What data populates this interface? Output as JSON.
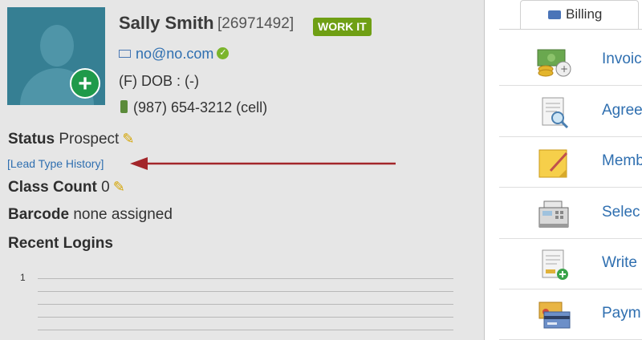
{
  "profile": {
    "name": "Sally Smith",
    "member_id": "[26971492]",
    "work_it_label": "WORK IT",
    "email": "no@no.com",
    "dob_text": "(F) DOB : (-)",
    "phone": "(987) 654-3212 (cell)",
    "status_label": "Status",
    "status_value": "Prospect",
    "lead_type_link": "[Lead Type History]",
    "class_count_label": "Class Count",
    "class_count_value": "0",
    "barcode_label": "Barcode",
    "barcode_value": "none assigned",
    "recent_logins_title": "Recent Logins",
    "chart_axis_value": "1"
  },
  "billing": {
    "tab_label": "Billing",
    "items": [
      {
        "label": "Invoic",
        "icon": "invoice-coins-icon"
      },
      {
        "label": "Agree",
        "icon": "agreement-document-icon"
      },
      {
        "label": "Memb",
        "icon": "membership-note-icon"
      },
      {
        "label": "Selec",
        "icon": "cash-register-icon"
      },
      {
        "label": "Write",
        "icon": "write-document-icon"
      },
      {
        "label": "Paym",
        "icon": "payment-cards-icon"
      }
    ]
  },
  "colors": {
    "link": "#2f6fb0",
    "badge": "#6f9f14",
    "arrow": "#a3262a",
    "panel_bg": "#e6e6e6"
  }
}
